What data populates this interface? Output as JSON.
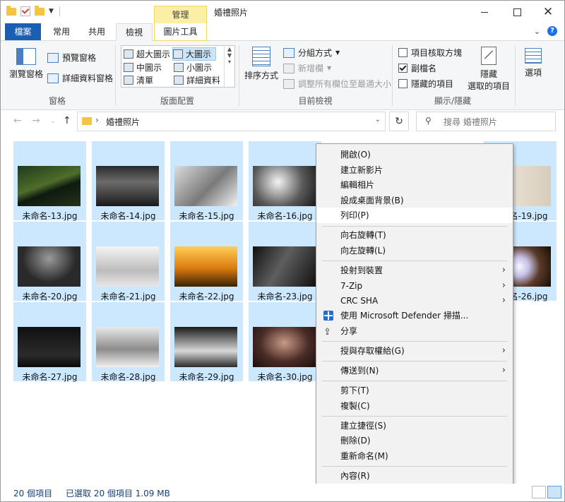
{
  "window": {
    "title": "婚禮照片",
    "context_tab": "管理"
  },
  "tabs": {
    "file": "檔案",
    "home": "常用",
    "share": "共用",
    "view": "檢視",
    "picture_tools": "圖片工具"
  },
  "ribbon": {
    "panes": {
      "nav_pane": "瀏覽窗格",
      "preview_pane": "預覽窗格",
      "details_pane": "詳細資料窗格",
      "label": "窗格"
    },
    "layout": {
      "items": [
        "超大圖示",
        "大圖示",
        "中圖示",
        "小圖示",
        "清單",
        "詳細資料"
      ],
      "label": "版面配置"
    },
    "current_view": {
      "sort_by": "排序方式",
      "group_by": "分組方式",
      "add_columns": "新增欄",
      "size_columns": "調整所有欄位至最適大小",
      "label": "目前檢視"
    },
    "show_hide": {
      "item_checkboxes": "項目核取方塊",
      "file_extensions": "副檔名",
      "hidden_items": "隱藏的項目",
      "hide_selected_line1": "隱藏",
      "hide_selected_line2": "選取的項目",
      "label": "顯示/隱藏"
    },
    "options": "選項"
  },
  "address": {
    "path": "婚禮照片",
    "search_placeholder": "搜尋 婚禮照片"
  },
  "files": [
    "未命名-13.jpg",
    "未命名-14.jpg",
    "未命名-15.jpg",
    "未命名-16.jpg",
    "未命名-19.jpg",
    "未命名-20.jpg",
    "未命名-21.jpg",
    "未命名-22.jpg",
    "未命名-23.jpg",
    "未命名-26.jpg",
    "未命名-27.jpg",
    "未命名-28.jpg",
    "未命名-29.jpg",
    "未命名-30.jpg"
  ],
  "context_menu": {
    "open": "開啟(O)",
    "new_video": "建立新影片",
    "edit_photo": "編輯相片",
    "set_wallpaper": "設成桌面背景(B)",
    "print": "列印(P)",
    "rotate_right": "向右旋轉(T)",
    "rotate_left": "向左旋轉(L)",
    "cast": "投射到裝置",
    "zip": "7-Zip",
    "crc": "CRC SHA",
    "defender": "使用 Microsoft Defender 掃描...",
    "share": "分享",
    "give_access": "授與存取權給(G)",
    "send_to": "傳送到(N)",
    "cut": "剪下(T)",
    "copy": "複製(C)",
    "create_shortcut": "建立捷徑(S)",
    "delete": "刪除(D)",
    "rename": "重新命名(M)",
    "properties": "內容(R)"
  },
  "status": {
    "count": "20 個項目",
    "selected": "已選取 20 個項目  1.09 MB"
  },
  "colors": {
    "file_tab": "#1a5fb4",
    "selection": "#cce8ff",
    "manage_tab": "#fbeea5"
  }
}
